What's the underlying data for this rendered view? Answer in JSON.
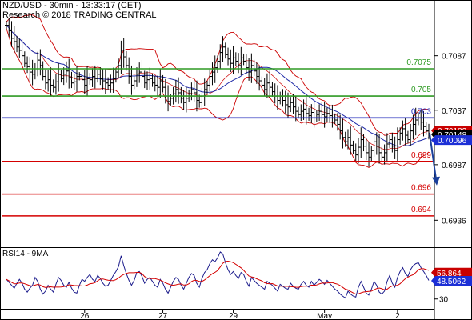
{
  "header": {
    "title": "NZD/USD - 30min - 13:33:17 (CET)",
    "subtitle": "Research © 2018 TRADING CENTRAL"
  },
  "rsi_label": "RSI14 - 9MA",
  "colors": {
    "background": "#ffffff",
    "candle": "#000000",
    "bollinger": "#cc0000",
    "ma": "#1f2aa8",
    "resistance": "#2e9a23",
    "pivot": "#1d25b8",
    "support": "#d40000",
    "arrow": "#1a3f9a",
    "rsi": "#1c1c8c",
    "rsi_ma": "#d40000",
    "label_red_bg": "#c90000",
    "label_black_bg": "#000000",
    "label_blue_bg": "#1c2fd6"
  },
  "chart_data": [
    {
      "type": "candlestick",
      "title": "NZD/USD - 30min - 13:33:17 (CET)",
      "ylim": [
        0.6912,
        0.7122
      ],
      "y_axis_ticks": [
        0.7087,
        0.7037,
        0.6987,
        0.6936
      ],
      "x_axis_ticks": [
        "26",
        "27",
        "29",
        "May",
        "2"
      ],
      "x_tick_positions_index": [
        30,
        60,
        87,
        122,
        150
      ],
      "horizontal_levels": [
        {
          "value": 0.7075,
          "label": "0.7075",
          "kind": "resistance"
        },
        {
          "value": 0.705,
          "label": "0.705",
          "kind": "resistance"
        },
        {
          "value": 0.703,
          "label": "0.703",
          "kind": "pivot"
        },
        {
          "value": 0.699,
          "label": "0.699",
          "kind": "support"
        },
        {
          "value": 0.696,
          "label": "0.696",
          "kind": "support"
        },
        {
          "value": 0.694,
          "label": "0.694",
          "kind": "support"
        }
      ],
      "price_labels": [
        {
          "value": 0.70183,
          "label": "0.70183",
          "style": "red"
        },
        {
          "value": 0.70148,
          "label": 0.70148,
          "style": "black"
        },
        {
          "value": 0.70096,
          "label": "0.70096",
          "style": "blue"
        }
      ],
      "forecast_arrow": {
        "from": 0.7016,
        "to": 0.6968
      },
      "price_path": [
        0.7115,
        0.711,
        0.7103,
        0.71,
        0.7095,
        0.7092,
        0.7087,
        0.708,
        0.7077,
        0.7072,
        0.707,
        0.7075,
        0.7083,
        0.7078,
        0.7068,
        0.7062,
        0.7065,
        0.706,
        0.7058,
        0.7063,
        0.707,
        0.7066,
        0.707,
        0.7073,
        0.7067,
        0.7062,
        0.7063,
        0.7068,
        0.7068,
        0.7065,
        0.706,
        0.7066,
        0.7065,
        0.7068,
        0.7066,
        0.707,
        0.7066,
        0.7064,
        0.7062,
        0.706,
        0.7062,
        0.7066,
        0.7072,
        0.7078,
        0.7092,
        0.7086,
        0.7078,
        0.7068,
        0.706,
        0.7064,
        0.707,
        0.7072,
        0.7068,
        0.7062,
        0.7065,
        0.7066,
        0.7062,
        0.706,
        0.7058,
        0.7064,
        0.7058,
        0.705,
        0.7045,
        0.7048,
        0.7052,
        0.7056,
        0.7053,
        0.7048,
        0.7044,
        0.7048,
        0.7052,
        0.7056,
        0.7053,
        0.7046,
        0.7044,
        0.705,
        0.7056,
        0.706,
        0.7068,
        0.7072,
        0.7076,
        0.7082,
        0.709,
        0.7095,
        0.7088,
        0.7084,
        0.708,
        0.7085,
        0.7082,
        0.7078,
        0.7085,
        0.7082,
        0.7076,
        0.7072,
        0.7078,
        0.7073,
        0.7068,
        0.7064,
        0.706,
        0.7056,
        0.7062,
        0.7058,
        0.7054,
        0.705,
        0.7046,
        0.705,
        0.7046,
        0.7042,
        0.704,
        0.7044,
        0.704,
        0.7036,
        0.7033,
        0.7036,
        0.7038,
        0.7034,
        0.7032,
        0.7035,
        0.703,
        0.7033,
        0.7036,
        0.7033,
        0.7031,
        0.7034,
        0.7032,
        0.703,
        0.7028,
        0.7024,
        0.7018,
        0.7012,
        0.7008,
        0.7012,
        0.7005,
        0.7,
        0.6996,
        0.7003,
        0.701,
        0.7004,
        0.6998,
        0.6994,
        0.7,
        0.7008,
        0.7004,
        0.6998,
        0.6994,
        0.6998,
        0.7006,
        0.701,
        0.7004,
        0.7,
        0.701,
        0.7016,
        0.702,
        0.7014,
        0.701,
        0.7018,
        0.7024,
        0.7028,
        0.703,
        0.7026,
        0.7022,
        0.7018,
        0.7016
      ]
    },
    {
      "type": "line",
      "title": "RSI14 - 9MA",
      "ylim": [
        20,
        82
      ],
      "y_axis_ticks": [
        30
      ],
      "value_labels": [
        {
          "value": 56.864,
          "label": "56.864",
          "series": "RSI MA"
        },
        {
          "value": 48.5062,
          "label": "48.5062",
          "series": "RSI"
        }
      ],
      "rsi_path": [
        50,
        47,
        44,
        41,
        46,
        50,
        46,
        40,
        37,
        41,
        44,
        52,
        48,
        40,
        35,
        38,
        44,
        40,
        37,
        45,
        52,
        49,
        44,
        42,
        47,
        41,
        37,
        36,
        44,
        50,
        48,
        52,
        55,
        50,
        48,
        54,
        51,
        46,
        43,
        44,
        49,
        54,
        58,
        63,
        74,
        64,
        56,
        49,
        44,
        49,
        57,
        58,
        53,
        46,
        50,
        52,
        48,
        44,
        42,
        50,
        46,
        40,
        36,
        42,
        48,
        52,
        50,
        44,
        40,
        46,
        52,
        56,
        54,
        46,
        42,
        51,
        57,
        60,
        66,
        70,
        68,
        72,
        78,
        76,
        67,
        60,
        55,
        58,
        54,
        51,
        57,
        55,
        48,
        43,
        52,
        49,
        46,
        44,
        42,
        40,
        48,
        46,
        44,
        41,
        38,
        45,
        43,
        41,
        40,
        46,
        43,
        41,
        40,
        45,
        48,
        44,
        42,
        48,
        44,
        47,
        50,
        48,
        45,
        49,
        46,
        43,
        40,
        38,
        35,
        33,
        31,
        38,
        35,
        33,
        32,
        42,
        48,
        42,
        36,
        34,
        40,
        48,
        44,
        37,
        35,
        38,
        48,
        54,
        46,
        42,
        52,
        58,
        62,
        56,
        53,
        60,
        64,
        66,
        67,
        62,
        58,
        54,
        49
      ]
    }
  ]
}
